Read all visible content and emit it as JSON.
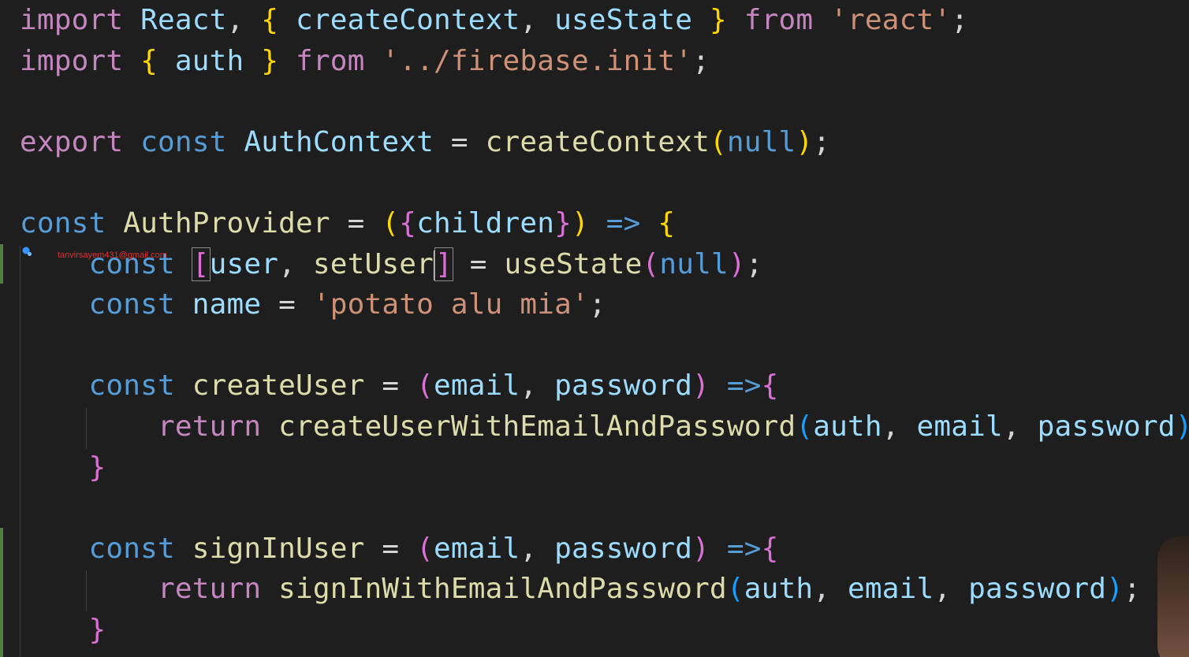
{
  "editor": {
    "watermark": "tanvirsayem431@gmail.com",
    "lines": [
      {
        "tokens": [
          {
            "t": "import",
            "c": "kw-ctrl"
          },
          {
            "t": " "
          },
          {
            "t": "React",
            "c": "ident"
          },
          {
            "t": ", "
          },
          {
            "t": "{",
            "c": "br1"
          },
          {
            "t": " "
          },
          {
            "t": "createContext",
            "c": "ident"
          },
          {
            "t": ", "
          },
          {
            "t": "useState",
            "c": "ident"
          },
          {
            "t": " "
          },
          {
            "t": "}",
            "c": "br1"
          },
          {
            "t": " "
          },
          {
            "t": "from",
            "c": "kw-ctrl"
          },
          {
            "t": " "
          },
          {
            "t": "'react'",
            "c": "str"
          },
          {
            "t": ";"
          }
        ]
      },
      {
        "tokens": [
          {
            "t": "import",
            "c": "kw-ctrl"
          },
          {
            "t": " "
          },
          {
            "t": "{",
            "c": "br1"
          },
          {
            "t": " "
          },
          {
            "t": "auth",
            "c": "ident"
          },
          {
            "t": " "
          },
          {
            "t": "}",
            "c": "br1"
          },
          {
            "t": " "
          },
          {
            "t": "from",
            "c": "kw-ctrl"
          },
          {
            "t": " "
          },
          {
            "t": "'../firebase.init'",
            "c": "str"
          },
          {
            "t": ";"
          }
        ]
      },
      {
        "tokens": []
      },
      {
        "tokens": [
          {
            "t": "export",
            "c": "kw-ctrl"
          },
          {
            "t": " "
          },
          {
            "t": "const",
            "c": "kw-decl"
          },
          {
            "t": " "
          },
          {
            "t": "AuthContext",
            "c": "ident"
          },
          {
            "t": " = "
          },
          {
            "t": "createContext",
            "c": "fn"
          },
          {
            "t": "(",
            "c": "br1"
          },
          {
            "t": "null",
            "c": "kw-decl"
          },
          {
            "t": ")",
            "c": "br1"
          },
          {
            "t": ";"
          }
        ]
      },
      {
        "tokens": []
      },
      {
        "tokens": [
          {
            "t": "const",
            "c": "kw-decl"
          },
          {
            "t": " "
          },
          {
            "t": "AuthProvider",
            "c": "fn"
          },
          {
            "t": " = "
          },
          {
            "t": "(",
            "c": "br1"
          },
          {
            "t": "{",
            "c": "br2"
          },
          {
            "t": "children",
            "c": "ident"
          },
          {
            "t": "}",
            "c": "br2"
          },
          {
            "t": ")",
            "c": "br1"
          },
          {
            "t": " "
          },
          {
            "t": "=>",
            "c": "kw-decl"
          },
          {
            "t": " "
          },
          {
            "t": "{",
            "c": "br1"
          }
        ]
      },
      {
        "tokens": [
          {
            "t": "    "
          },
          {
            "t": "const",
            "c": "kw-decl"
          },
          {
            "t": " "
          },
          {
            "t": "[",
            "c": "br2",
            "box": true
          },
          {
            "t": "user",
            "c": "ident"
          },
          {
            "t": ", "
          },
          {
            "t": "setUser",
            "c": "fn"
          },
          {
            "t": "",
            "caret": true
          },
          {
            "t": "]",
            "c": "br2",
            "box": true
          },
          {
            "t": " = "
          },
          {
            "t": "useState",
            "c": "fn"
          },
          {
            "t": "(",
            "c": "br2"
          },
          {
            "t": "null",
            "c": "kw-decl"
          },
          {
            "t": ")",
            "c": "br2"
          },
          {
            "t": ";"
          }
        ]
      },
      {
        "tokens": [
          {
            "t": "    "
          },
          {
            "t": "const",
            "c": "kw-decl"
          },
          {
            "t": " "
          },
          {
            "t": "name",
            "c": "ident"
          },
          {
            "t": " = "
          },
          {
            "t": "'potato alu mia'",
            "c": "str"
          },
          {
            "t": ";"
          }
        ]
      },
      {
        "tokens": []
      },
      {
        "tokens": [
          {
            "t": "    "
          },
          {
            "t": "const",
            "c": "kw-decl"
          },
          {
            "t": " "
          },
          {
            "t": "createUser",
            "c": "fn"
          },
          {
            "t": " = "
          },
          {
            "t": "(",
            "c": "br2"
          },
          {
            "t": "email",
            "c": "ident"
          },
          {
            "t": ", "
          },
          {
            "t": "password",
            "c": "ident"
          },
          {
            "t": ")",
            "c": "br2"
          },
          {
            "t": " "
          },
          {
            "t": "=>",
            "c": "kw-decl"
          },
          {
            "t": "{",
            "c": "br2"
          }
        ]
      },
      {
        "tokens": [
          {
            "t": "        "
          },
          {
            "t": "return",
            "c": "kw-ctrl"
          },
          {
            "t": " "
          },
          {
            "t": "createUserWithEmailAndPassword",
            "c": "fn"
          },
          {
            "t": "(",
            "c": "br3"
          },
          {
            "t": "auth",
            "c": "ident"
          },
          {
            "t": ", "
          },
          {
            "t": "email",
            "c": "ident"
          },
          {
            "t": ", "
          },
          {
            "t": "password",
            "c": "ident"
          },
          {
            "t": ")",
            "c": "br3"
          },
          {
            "t": ";"
          }
        ]
      },
      {
        "tokens": [
          {
            "t": "    "
          },
          {
            "t": "}",
            "c": "br2"
          }
        ]
      },
      {
        "tokens": []
      },
      {
        "tokens": [
          {
            "t": "    "
          },
          {
            "t": "const",
            "c": "kw-decl"
          },
          {
            "t": " "
          },
          {
            "t": "signInUser",
            "c": "fn"
          },
          {
            "t": " = "
          },
          {
            "t": "(",
            "c": "br2"
          },
          {
            "t": "email",
            "c": "ident"
          },
          {
            "t": ", "
          },
          {
            "t": "password",
            "c": "ident"
          },
          {
            "t": ")",
            "c": "br2"
          },
          {
            "t": " "
          },
          {
            "t": "=>",
            "c": "kw-decl"
          },
          {
            "t": "{",
            "c": "br2"
          }
        ]
      },
      {
        "tokens": [
          {
            "t": "        "
          },
          {
            "t": "return",
            "c": "kw-ctrl"
          },
          {
            "t": " "
          },
          {
            "t": "signInWithEmailAndPassword",
            "c": "fn"
          },
          {
            "t": "(",
            "c": "br3"
          },
          {
            "t": "auth",
            "c": "ident"
          },
          {
            "t": ", "
          },
          {
            "t": "email",
            "c": "ident"
          },
          {
            "t": ", "
          },
          {
            "t": "password",
            "c": "ident"
          },
          {
            "t": ")",
            "c": "br3"
          },
          {
            "t": ";"
          }
        ]
      },
      {
        "tokens": [
          {
            "t": "    "
          },
          {
            "t": "}",
            "c": "br2"
          }
        ]
      }
    ]
  },
  "icons": {
    "lightbulb": "lightbulb-icon"
  },
  "colors": {
    "background": "#1e1e1e",
    "keyword_control": "#c586c0",
    "keyword_declaration": "#569cd6",
    "identifier": "#9cdcfe",
    "function": "#dcdcaa",
    "string": "#ce9178",
    "bracket_level1": "#ffd700",
    "bracket_level2": "#da70d6",
    "bracket_level3": "#179fff",
    "watermark": "#e03030"
  }
}
